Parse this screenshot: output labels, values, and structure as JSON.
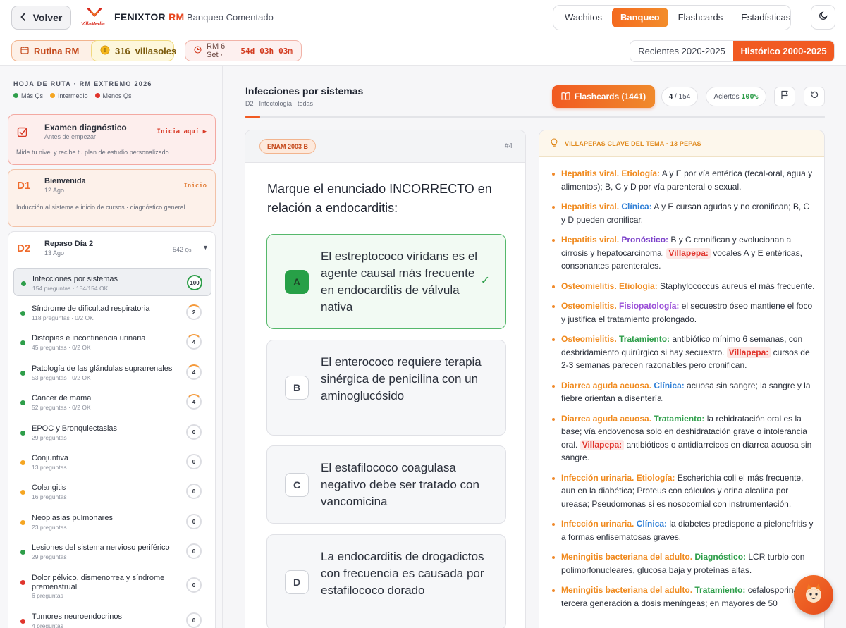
{
  "header": {
    "back_label": "Volver",
    "logo_text": "VillaMedic",
    "brand_main": "FENIXTOR",
    "brand_accent": "RM",
    "breadcrumb": "· Banqueo Comentado",
    "tabs": [
      {
        "label": "Wachitos",
        "active": false
      },
      {
        "label": "Banqueo",
        "active": true
      },
      {
        "label": "Flashcards",
        "active": false
      },
      {
        "label": "Estadísticas",
        "active": false
      }
    ],
    "theme_icon": "moon-icon"
  },
  "toolbar": {
    "rutina_label": "Rutina RM",
    "villasoles_count": "316",
    "villasoles_label": "villasoles",
    "countdown_prefix": "RM 6 Set ·",
    "countdown_days": "54d",
    "countdown_hours": "03h",
    "countdown_mins": "03m",
    "range_recent": "Recientes 2020-2025",
    "range_hist": "Histórico 2000-2025"
  },
  "sidebar": {
    "title": "HOJA DE RUTA · RM EXTREMO 2026",
    "legend": [
      {
        "label": "Más Qs",
        "color": "#2e9e4a"
      },
      {
        "label": "Intermedio",
        "color": "#f5a623"
      },
      {
        "label": "Menos Qs",
        "color": "#e0342c"
      }
    ],
    "exam": {
      "title": "Examen diagnóstico",
      "sub": "Antes de empezar",
      "cta": "Inicia aquí ▶",
      "desc": "Mide tu nivel y recibe tu plan de estudio personalizado."
    },
    "d1": {
      "num": "D1",
      "title": "Bienvenida",
      "date": "12 Ago",
      "cta": "Inicio",
      "desc": "Inducción al sistema e inicio de cursos · diagnóstico general"
    },
    "d2": {
      "num": "D2",
      "title": "Repaso Día 2",
      "date": "13 Ago",
      "count": "542",
      "count_unit": "Qs",
      "caret": "▼",
      "topics": [
        {
          "name": "Infecciones por sistemas",
          "meta": "154 preguntas · 154/154 OK",
          "score": "100",
          "dot": "#2e9e4a"
        },
        {
          "name": "Síndrome de dificultad respiratoria",
          "meta": "118 preguntas · 0/2 OK",
          "score": "2",
          "dot": "#2e9e4a"
        },
        {
          "name": "Distopias e incontinencia urinaria",
          "meta": "45 preguntas · 0/2 OK",
          "score": "4",
          "dot": "#2e9e4a"
        },
        {
          "name": "Patología de las glándulas suprarrenales",
          "meta": "53 preguntas · 0/2 OK",
          "score": "4",
          "dot": "#2e9e4a"
        },
        {
          "name": "Cáncer de mama",
          "meta": "52 preguntas · 0/2 OK",
          "score": "4",
          "dot": "#2e9e4a"
        },
        {
          "name": "EPOC y Bronquiectasias",
          "meta": "29 preguntas",
          "score": "0",
          "dot": "#2e9e4a"
        },
        {
          "name": "Conjuntiva",
          "meta": "13 preguntas",
          "score": "0",
          "dot": "#f5a623"
        },
        {
          "name": "Colangitis",
          "meta": "16 preguntas",
          "score": "0",
          "dot": "#f5a623"
        },
        {
          "name": "Neoplasias pulmonares",
          "meta": "23 preguntas",
          "score": "0",
          "dot": "#f5a623"
        },
        {
          "name": "Lesiones del sistema nervioso periférico",
          "meta": "29 preguntas",
          "score": "0",
          "dot": "#2e9e4a"
        },
        {
          "name": "Dolor pélvico, dismenorrea y síndrome premenstrual",
          "meta": "6 preguntas",
          "score": "0",
          "dot": "#e0342c"
        },
        {
          "name": "Tumores neuroendocrinos",
          "meta": "4 preguntas",
          "score": "0",
          "dot": "#e0342c"
        }
      ]
    }
  },
  "question": {
    "topic_title": "Infecciones por sistemas",
    "topic_sub": "D2 · Infectología · todas",
    "progress_fraction": 0.026,
    "flashcards_label": "Flashcards (1441)",
    "position_current": "4",
    "position_total": "/ 154",
    "aciertos_label": "Aciertos",
    "aciertos_value": "100%",
    "tag": "ENAM 2003 B",
    "number": "#4",
    "stem": "Marque el enunciado INCORRECTO en relación a endocarditis:",
    "options": [
      {
        "letter": "A",
        "text": "El estreptococo virídans es el agente causal más frecuente en endocarditis de válvula nativa",
        "correct": true
      },
      {
        "letter": "B",
        "text": "El enterococo requiere terapia sinérgica de penicilina con un aminoglucósido",
        "correct": false
      },
      {
        "letter": "C",
        "text": "El estafilococo coagulasa negativo debe ser tratado con vancomicina",
        "correct": false
      },
      {
        "letter": "D",
        "text": "La endocarditis de drogadictos con frecuencia es causada por estafilococo dorado",
        "correct": false
      }
    ],
    "check_mark": "✓"
  },
  "tips": {
    "header": "VILLAPEPAS CLAVE DEL TEMA · 13 PEPAS",
    "aspect_colors": {
      "Etiología": "#f08a1e",
      "Clínica": "#2f7fd6",
      "Pronóstico": "#7a3fc9",
      "Fisiopatología": "#9b4fd8",
      "Tratamiento": "#2e9e4a",
      "Diagnóstico": "#2e9e4a"
    },
    "items": [
      {
        "topic": "Hepatitis viral.",
        "aspect": "Etiología:",
        "aspect_color": "#f08a1e",
        "text": " A y E por vía entérica (fecal-oral, agua y alimentos); B, C y D por vía parenteral o sexual.",
        "villa": "",
        "villa_text": ""
      },
      {
        "topic": "Hepatitis viral.",
        "aspect": "Clínica:",
        "aspect_color": "#2f7fd6",
        "text": " A y E cursan agudas y no cronifican; B, C y D pueden cronificar.",
        "villa": "",
        "villa_text": ""
      },
      {
        "topic": "Hepatitis viral.",
        "aspect": "Pronóstico:",
        "aspect_color": "#7a3fc9",
        "text": " B y C cronifican y evolucionan a cirrosis y hepatocarcinoma.",
        "villa": "Villapepa:",
        "villa_text": " vocales A y E entéricas, consonantes parenterales."
      },
      {
        "topic": "Osteomielitis.",
        "aspect": "Etiología:",
        "aspect_color": "#f08a1e",
        "text": " Staphylococcus aureus el más frecuente.",
        "villa": "",
        "villa_text": ""
      },
      {
        "topic": "Osteomielitis.",
        "aspect": "Fisiopatología:",
        "aspect_color": "#9b4fd8",
        "text": " el secuestro óseo mantiene el foco y justifica el tratamiento prolongado.",
        "villa": "",
        "villa_text": ""
      },
      {
        "topic": "Osteomielitis.",
        "aspect": "Tratamiento:",
        "aspect_color": "#2e9e4a",
        "text": " antibiótico mínimo 6 semanas, con desbridamiento quirúrgico si hay secuestro.",
        "villa": "Villapepa:",
        "villa_text": " cursos de 2-3 semanas parecen razonables pero cronifican."
      },
      {
        "topic": "Diarrea aguda acuosa.",
        "aspect": "Clínica:",
        "aspect_color": "#2f7fd6",
        "text": " acuosa sin sangre; la sangre y la fiebre orientan a disentería.",
        "villa": "",
        "villa_text": ""
      },
      {
        "topic": "Diarrea aguda acuosa.",
        "aspect": "Tratamiento:",
        "aspect_color": "#2e9e4a",
        "text": " la rehidratación oral es la base; vía endovenosa solo en deshidratación grave o intolerancia oral.",
        "villa": "Villapepa:",
        "villa_text": " antibióticos o antidiarreicos en diarrea acuosa sin sangre."
      },
      {
        "topic": "Infección urinaria.",
        "aspect": "Etiología:",
        "aspect_color": "#f08a1e",
        "text": " Escherichia coli el más frecuente, aun en la diabética; Proteus con cálculos y orina alcalina por ureasa; Pseudomonas si es nosocomial con instrumentación.",
        "villa": "",
        "villa_text": ""
      },
      {
        "topic": "Infección urinaria.",
        "aspect": "Clínica:",
        "aspect_color": "#2f7fd6",
        "text": " la diabetes predispone a pielonefritis y a formas enfisematosas graves.",
        "villa": "",
        "villa_text": ""
      },
      {
        "topic": "Meningitis bacteriana del adulto.",
        "aspect": "Diagnóstico:",
        "aspect_color": "#2e9e4a",
        "text": " LCR turbio con polimorfonucleares, glucosa baja y proteínas altas.",
        "villa": "",
        "villa_text": ""
      },
      {
        "topic": "Meningitis bacteriana del adulto.",
        "aspect": "Tratamiento:",
        "aspect_color": "#2e9e4a",
        "text": " cefalosporina de tercera generación a dosis meníngeas; en mayores de 50",
        "villa": "",
        "villa_text": ""
      }
    ]
  }
}
